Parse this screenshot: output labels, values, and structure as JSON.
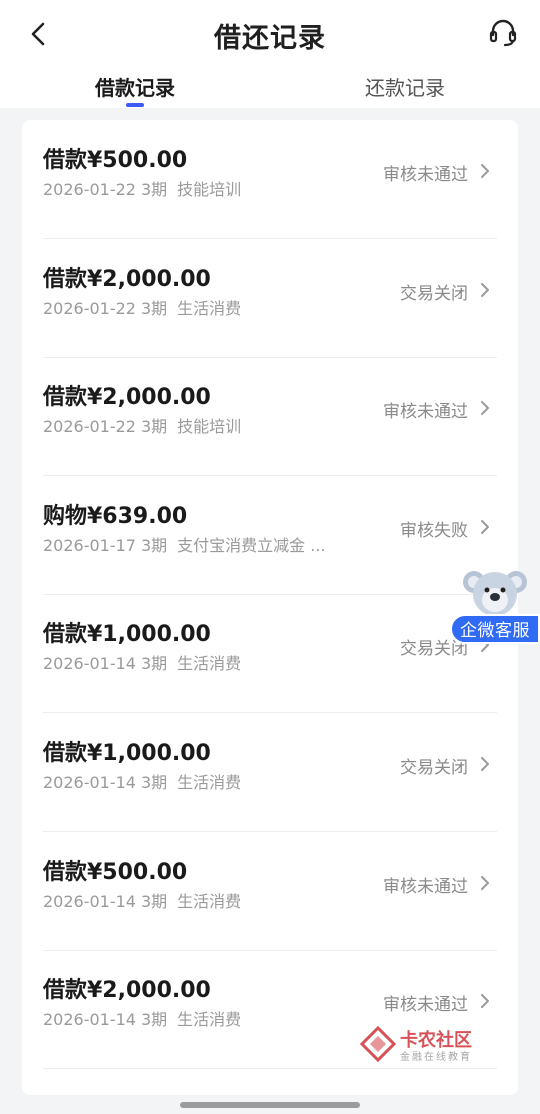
{
  "header": {
    "title": "借还记录"
  },
  "tabs": [
    {
      "label": "借款记录",
      "active": true
    },
    {
      "label": "还款记录",
      "active": false
    }
  ],
  "records": [
    {
      "amount": "借款¥500.00",
      "date": "2026-01-22",
      "periods": "3期",
      "purpose": "技能培训",
      "status": "审核未通过"
    },
    {
      "amount": "借款¥2,000.00",
      "date": "2026-01-22",
      "periods": "3期",
      "purpose": "生活消费",
      "status": "交易关闭"
    },
    {
      "amount": "借款¥2,000.00",
      "date": "2026-01-22",
      "periods": "3期",
      "purpose": "技能培训",
      "status": "审核未通过"
    },
    {
      "amount": "购物¥639.00",
      "date": "2026-01-17",
      "periods": "3期",
      "purpose": "支付宝消费立减金 ...",
      "status": "审核失败"
    },
    {
      "amount": "借款¥1,000.00",
      "date": "2026-01-14",
      "periods": "3期",
      "purpose": "生活消费",
      "status": "交易关闭"
    },
    {
      "amount": "借款¥1,000.00",
      "date": "2026-01-14",
      "periods": "3期",
      "purpose": "生活消费",
      "status": "交易关闭"
    },
    {
      "amount": "借款¥500.00",
      "date": "2026-01-14",
      "periods": "3期",
      "purpose": "生活消费",
      "status": "审核未通过"
    },
    {
      "amount": "借款¥2,000.00",
      "date": "2026-01-14",
      "periods": "3期",
      "purpose": "生活消费",
      "status": "审核未通过"
    }
  ],
  "floating_service": {
    "label": "企微客服",
    "icon": "koala-mascot-icon"
  },
  "watermark": {
    "main": "卡农社区",
    "sub": "金融在线教育"
  },
  "colors": {
    "accent": "#3d5bf5",
    "service_badge": "#2f6bf5",
    "status_text": "#8a8a8a",
    "watermark": "#c9191e"
  }
}
